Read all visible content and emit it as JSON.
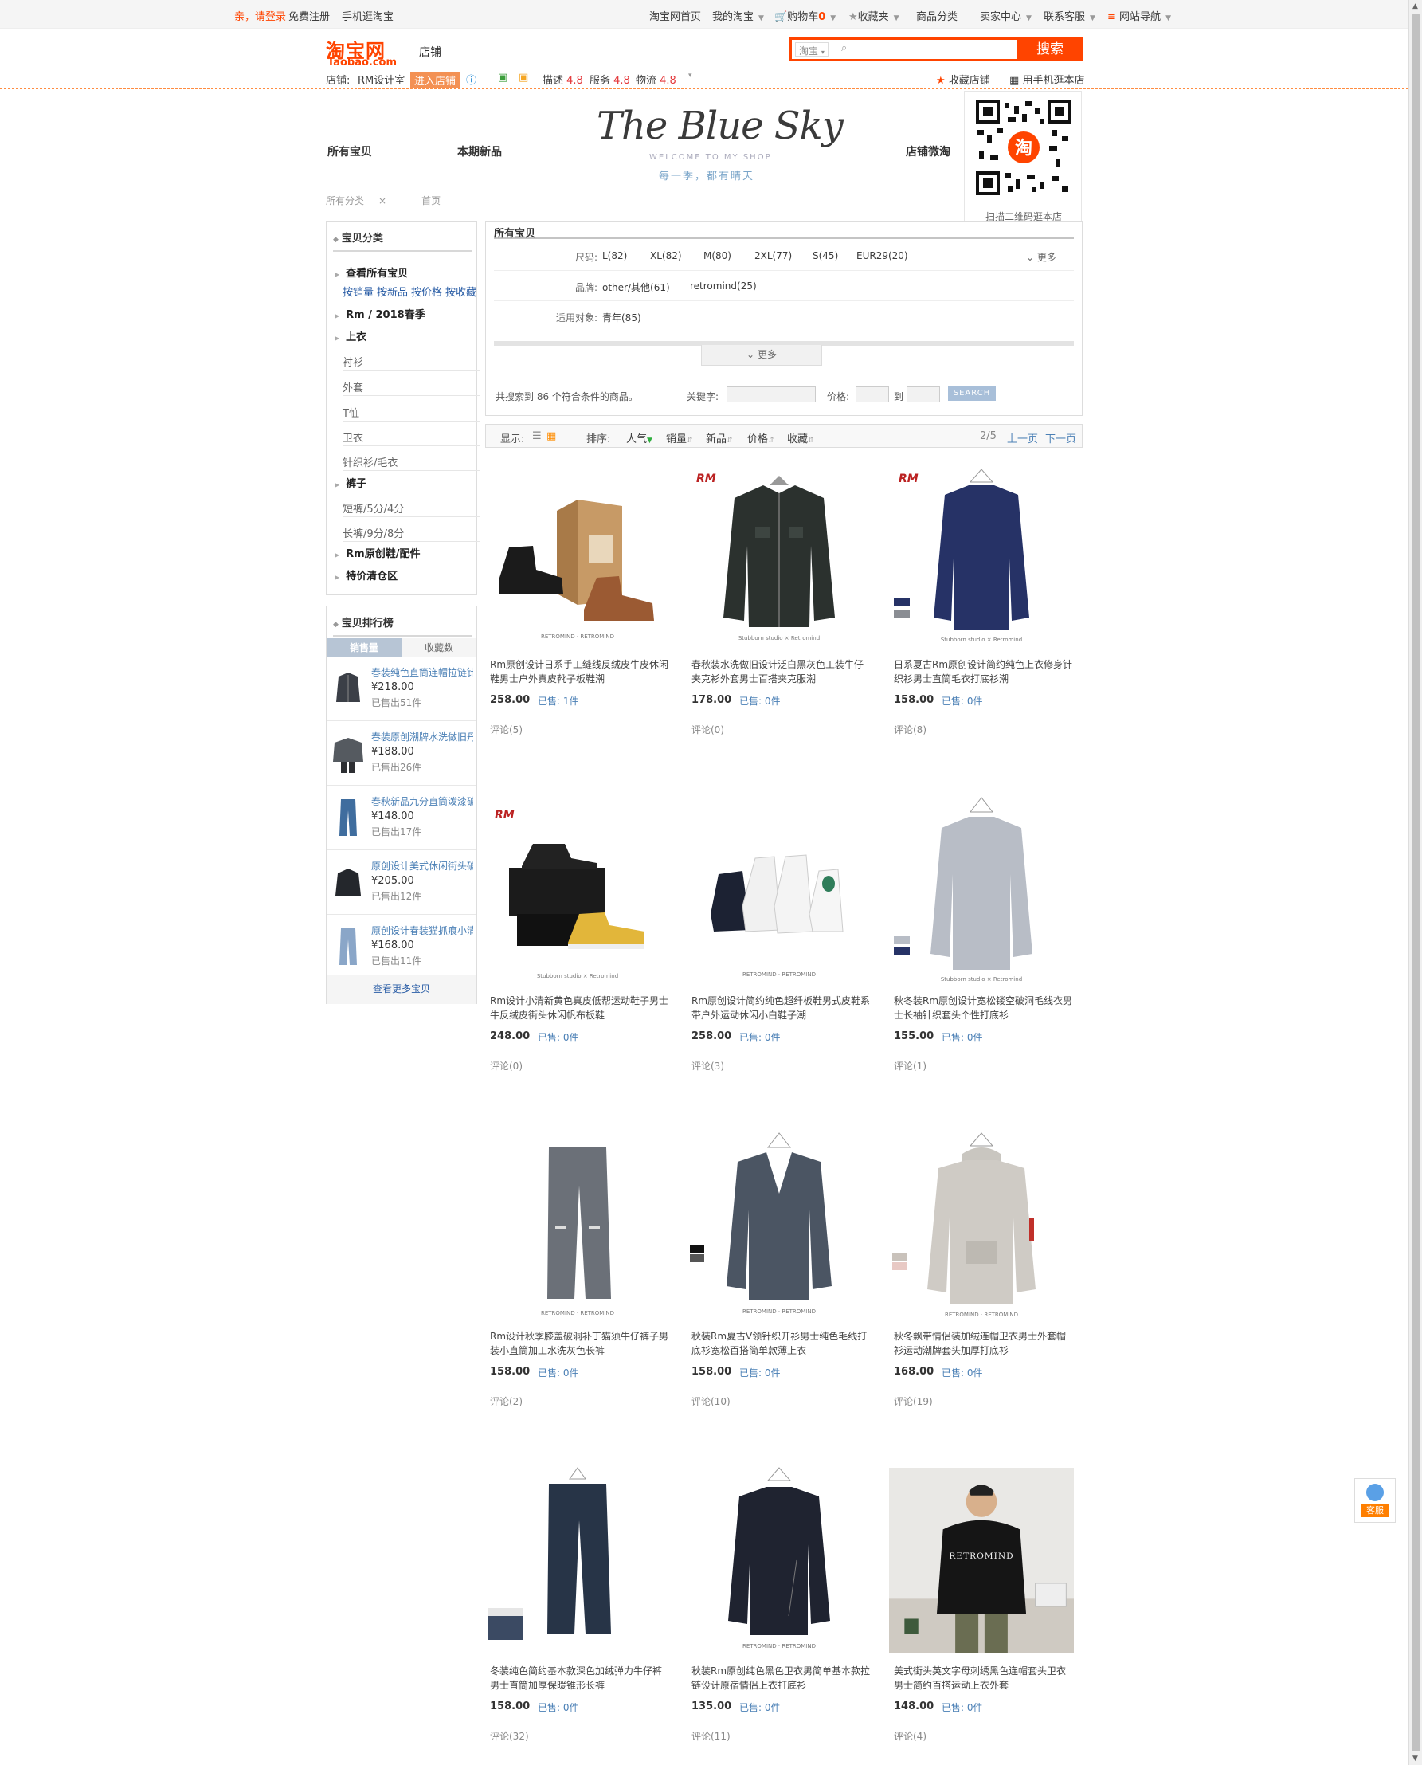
{
  "topbar": {
    "login_prefix": "亲，请登录",
    "register": "免费注册",
    "mobile": "手机逛淘宝",
    "home": "淘宝网首页",
    "my_taobao": "我的淘宝",
    "cart_label": "购物车",
    "cart_count": "0",
    "favorites": "收藏夹",
    "categories": "商品分类",
    "seller_center": "卖家中心",
    "support": "联系客服",
    "site_nav": "网站导航"
  },
  "header": {
    "logo_cn": "淘宝网",
    "logo_en": "Taobao.com",
    "type_label": "店铺",
    "search_scope": "淘宝",
    "search_placeholder": "",
    "search_button": "搜索"
  },
  "shop_info": {
    "shop_label": "店铺:",
    "shop_name": "RM设计室",
    "enter_label": "进入店铺",
    "desc_label": "描述",
    "desc_score": "4.8",
    "service_label": "服务",
    "service_score": "4.8",
    "logistics_label": "物流",
    "logistics_score": "4.8",
    "collect_label": "收藏店铺",
    "mobile_label": "用手机逛本店"
  },
  "banner": {
    "nav_all": "所有宝贝",
    "nav_new": "本期新品",
    "nav_weitao": "店铺微淘",
    "brand_script": "The Blue Sky",
    "brand_welcome": "WELCOME TO MY SHOP",
    "brand_tagline": "每一季，都有晴天",
    "qr_caption": "扫描二维码逛本店"
  },
  "breadcrumb": {
    "all": "所有分类",
    "close": "×",
    "home": "首页"
  },
  "category": {
    "title": "宝贝分类",
    "view_all": "查看所有宝贝",
    "sort_links": [
      "按销量",
      "按新品",
      "按价格",
      "按收藏"
    ],
    "items": [
      {
        "label": "Rm / 2018春季",
        "bold": true
      },
      {
        "label": "上衣",
        "bold": true
      },
      {
        "label": "衬衫",
        "bold": false
      },
      {
        "label": "外套",
        "bold": false
      },
      {
        "label": "T恤",
        "bold": false
      },
      {
        "label": "卫衣",
        "bold": false
      },
      {
        "label": "针织衫/毛衣",
        "bold": false
      },
      {
        "label": "裤子",
        "bold": true
      },
      {
        "label": "短裤/5分/4分",
        "bold": false
      },
      {
        "label": "长裤/9分/8分",
        "bold": false
      },
      {
        "label": "Rm原创鞋/配件",
        "bold": true
      },
      {
        "label": "特价清仓区",
        "bold": true
      }
    ]
  },
  "ranking": {
    "title": "宝贝排行榜",
    "tab_sales": "销售量",
    "tab_collect": "收藏数",
    "items": [
      {
        "name": "春装纯色直筒连帽拉链针织开衫",
        "price": "¥218.00",
        "sold": "已售出51件"
      },
      {
        "name": "春装原创潮牌水洗做旧丹宁外套",
        "price": "¥188.00",
        "sold": "已售出26件"
      },
      {
        "name": "春秋新品九分直筒泼漆破洞牛仔裤",
        "price": "¥148.00",
        "sold": "已售出17件"
      },
      {
        "name": "原创设计美式休闲街头破洞夹克",
        "price": "¥205.00",
        "sold": "已售出12件"
      },
      {
        "name": "原创设计春装猫抓痕小清新牛仔裤",
        "price": "¥168.00",
        "sold": "已售出11件"
      }
    ],
    "more": "查看更多宝贝"
  },
  "filter": {
    "title": "所有宝贝",
    "size_label": "尺码:",
    "sizes": [
      "L(82)",
      "XL(82)",
      "M(80)",
      "2XL(77)",
      "S(45)",
      "EUR29(20)"
    ],
    "more": "更多",
    "brand_label": "品牌:",
    "brands": [
      "other/其他(61)",
      "retromind(25)"
    ],
    "target_label": "适用对象:",
    "targets": [
      "青年(85)"
    ],
    "result_text": "共搜索到 86 个符合条件的商品。",
    "keyword_label": "关键字:",
    "price_label": "价格:",
    "to_label": "到",
    "search_button": "SEARCH"
  },
  "sortbar": {
    "display_label": "显示:",
    "sort_label": "排序:",
    "popularity": "人气",
    "sales": "销量",
    "newest": "新品",
    "price": "价格",
    "collect": "收藏",
    "page": "2/5",
    "prev": "上一页",
    "next": "下一页"
  },
  "products": [
    {
      "name": "Rm原创设计日系手工缝线反绒皮牛皮休闲鞋男士户外真皮靴子板鞋潮",
      "price": "258.00",
      "sold": "已售: 1件",
      "reviews": "评论(5)"
    },
    {
      "name": "春秋装水洗做旧设计泛白黑灰色工装牛仔夹克衫外套男士百搭夹克服潮",
      "price": "178.00",
      "sold": "已售: 0件",
      "reviews": "评论(0)"
    },
    {
      "name": "日系夏古Rm原创设计简约纯色上衣修身针织衫男士直筒毛衣打底衫潮",
      "price": "158.00",
      "sold": "已售: 0件",
      "reviews": "评论(8)"
    },
    {
      "name": "Rm设计小清新黄色真皮低帮运动鞋子男士牛反绒皮街头休闲帆布板鞋",
      "price": "248.00",
      "sold": "已售: 0件",
      "reviews": "评论(0)"
    },
    {
      "name": "Rm原创设计简约纯色超纤板鞋男式皮鞋系带户外运动休闲小白鞋子潮",
      "price": "258.00",
      "sold": "已售: 0件",
      "reviews": "评论(3)"
    },
    {
      "name": "秋冬装Rm原创设计宽松镂空破洞毛线衣男士长袖针织套头个性打底衫",
      "price": "155.00",
      "sold": "已售: 0件",
      "reviews": "评论(1)"
    },
    {
      "name": "Rm设计秋季膝盖破洞补丁猫须牛仔裤子男装小直筒加工水洗灰色长裤",
      "price": "158.00",
      "sold": "已售: 0件",
      "reviews": "评论(2)"
    },
    {
      "name": "秋装Rm夏古V领针织开衫男士纯色毛线打底衫宽松百搭简单款薄上衣",
      "price": "158.00",
      "sold": "已售: 0件",
      "reviews": "评论(10)"
    },
    {
      "name": "秋冬飘带情侣装加绒连帽卫衣男士外套帽衫运动潮牌套头加厚打底衫",
      "price": "168.00",
      "sold": "已售: 0件",
      "reviews": "评论(19)"
    },
    {
      "name": "冬装纯色简约基本款深色加绒弹力牛仔裤男士直筒加厚保暖锥形长裤",
      "price": "158.00",
      "sold": "已售: 0件",
      "reviews": "评论(32)"
    },
    {
      "name": "秋装Rm原创纯色黑色卫衣男简单基本款拉链设计原宿情侣上衣打底衫",
      "price": "135.00",
      "sold": "已售: 0件",
      "reviews": "评论(11)"
    },
    {
      "name": "美式街头英文字母刺绣黑色连帽套头卫衣男士简约百搭运动上衣外套",
      "price": "148.00",
      "sold": "已售: 0件",
      "reviews": "评论(4)"
    }
  ],
  "service": {
    "label": "客服"
  },
  "colors": {
    "accent": "#ff4400",
    "link": "#4a7fb5",
    "price": "#333333"
  }
}
